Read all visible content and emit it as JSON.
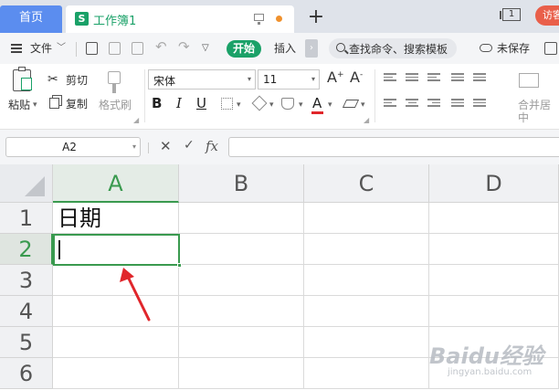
{
  "tabs": {
    "home_label": "首页",
    "doc_logo": "S",
    "doc_title": "工作簿1",
    "new_tab": "+",
    "page_indicator": "1",
    "visitor_label": "访客"
  },
  "menu": {
    "file_label": "文件",
    "start_label": "开始",
    "insert_label": "插入",
    "search_label": "查找命令、搜索模板",
    "unsaved_label": "未保存"
  },
  "ribbon": {
    "paste_label": "粘贴",
    "cut_label": "剪切",
    "copy_label": "复制",
    "format_painter_label": "格式刷",
    "font_name": "宋体",
    "font_size": "11",
    "bold": "B",
    "italic": "I",
    "underline": "U",
    "font_color_glyph": "A",
    "increase_font": "A",
    "decrease_font": "A",
    "merge_center_label": "合并居中"
  },
  "formula_bar": {
    "cell_ref": "A2",
    "fx_label": "fx",
    "formula_value": ""
  },
  "sheet": {
    "columns": [
      "A",
      "B",
      "C",
      "D"
    ],
    "rows": [
      "1",
      "2",
      "3",
      "4",
      "5",
      "6"
    ],
    "active_cell": "A2",
    "cells": {
      "A1": "日期"
    }
  },
  "colors": {
    "accent_green": "#3a9a4f",
    "wps_green": "#1aa168",
    "home_blue": "#5b8def",
    "annotation_red": "#e0262b"
  },
  "watermark": {
    "main": "Baidu经验",
    "sub": "jingyan.baidu.com"
  }
}
